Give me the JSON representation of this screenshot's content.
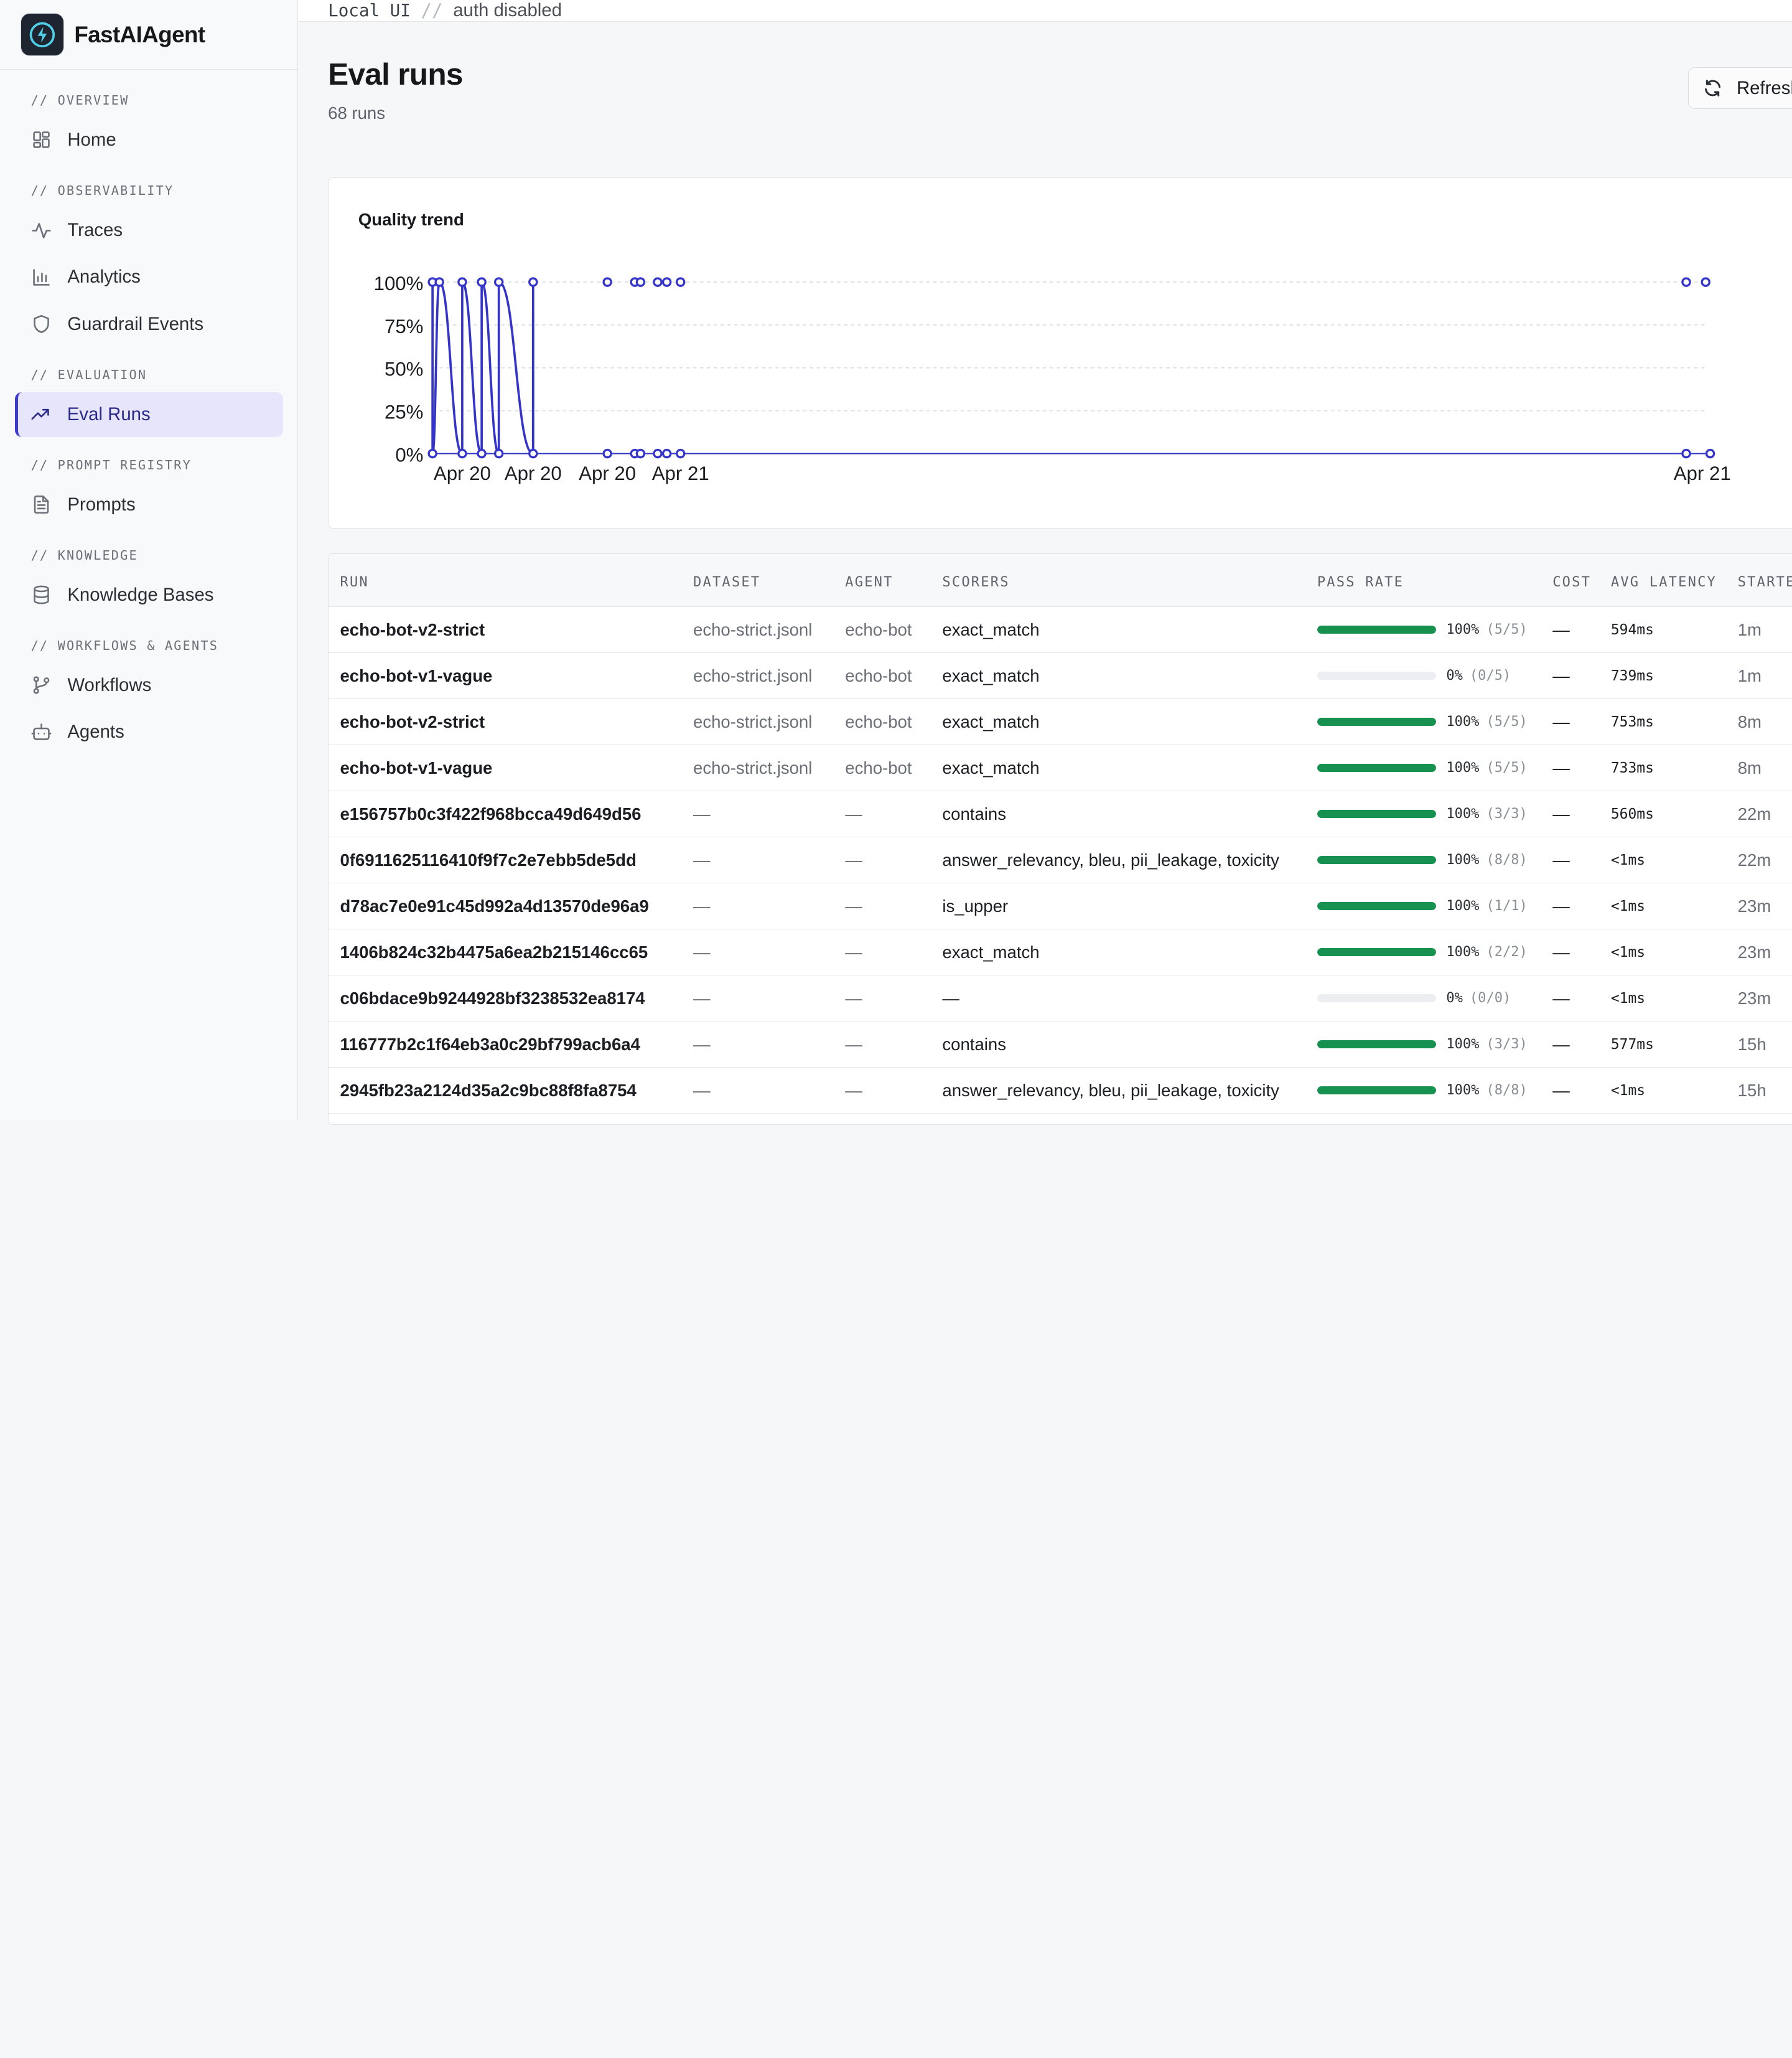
{
  "brand": {
    "name": "FastAIAgent"
  },
  "topbar": {
    "mode": "Local UI",
    "separator": "//",
    "auth": "auth disabled"
  },
  "nav": {
    "sections": [
      {
        "heading": "// OVERVIEW",
        "items": [
          {
            "label": "Home",
            "icon": "grid-icon"
          }
        ]
      },
      {
        "heading": "// OBSERVABILITY",
        "items": [
          {
            "label": "Traces",
            "icon": "pulse-icon"
          },
          {
            "label": "Analytics",
            "icon": "bar-chart-icon"
          },
          {
            "label": "Guardrail Events",
            "icon": "shield-icon"
          }
        ]
      },
      {
        "heading": "// EVALUATION",
        "items": [
          {
            "label": "Eval Runs",
            "icon": "trending-up-icon",
            "active": true
          }
        ]
      },
      {
        "heading": "// PROMPT REGISTRY",
        "items": [
          {
            "label": "Prompts",
            "icon": "document-icon"
          }
        ]
      },
      {
        "heading": "// KNOWLEDGE",
        "items": [
          {
            "label": "Knowledge Bases",
            "icon": "database-icon"
          }
        ]
      },
      {
        "heading": "// WORKFLOWS & AGENTS",
        "items": [
          {
            "label": "Workflows",
            "icon": "branch-icon"
          },
          {
            "label": "Agents",
            "icon": "robot-icon"
          }
        ]
      }
    ]
  },
  "page": {
    "title": "Eval runs",
    "subtitle": "68 runs",
    "refresh_label": "Refresh"
  },
  "chart_data": {
    "type": "line",
    "title": "Quality trend",
    "ylim": [
      0,
      100
    ],
    "yticks": [
      "0%",
      "25%",
      "50%",
      "75%",
      "100%"
    ],
    "xticks": [
      "Apr 20",
      "Apr 20",
      "Apr 20",
      "Apr 21",
      "Apr 21"
    ],
    "grid": true,
    "series": [
      {
        "values": [
          100,
          0,
          100,
          0,
          100,
          0,
          100,
          0,
          100,
          0,
          100,
          0,
          100,
          0,
          100,
          0,
          100,
          0,
          100,
          0,
          100,
          0,
          100,
          0,
          100,
          0,
          100,
          0,
          100,
          0,
          100,
          0,
          100,
          0
        ]
      }
    ]
  },
  "table": {
    "columns": [
      "RUN",
      "DATASET",
      "AGENT",
      "SCORERS",
      "PASS RATE",
      "COST",
      "AVG LATENCY",
      "STARTED"
    ],
    "rows": [
      {
        "run": "echo-bot-v2-strict",
        "dataset": "echo-strict.jsonl",
        "agent": "echo-bot",
        "scorers": "exact_match",
        "pass": 100,
        "pct": "100%",
        "frac": "(5/5)",
        "cost": "—",
        "latency": "594ms",
        "started": "1m"
      },
      {
        "run": "echo-bot-v1-vague",
        "dataset": "echo-strict.jsonl",
        "agent": "echo-bot",
        "scorers": "exact_match",
        "pass": 0,
        "pct": "0%",
        "frac": "(0/5)",
        "cost": "—",
        "latency": "739ms",
        "started": "1m"
      },
      {
        "run": "echo-bot-v2-strict",
        "dataset": "echo-strict.jsonl",
        "agent": "echo-bot",
        "scorers": "exact_match",
        "pass": 100,
        "pct": "100%",
        "frac": "(5/5)",
        "cost": "—",
        "latency": "753ms",
        "started": "8m"
      },
      {
        "run": "echo-bot-v1-vague",
        "dataset": "echo-strict.jsonl",
        "agent": "echo-bot",
        "scorers": "exact_match",
        "pass": 100,
        "pct": "100%",
        "frac": "(5/5)",
        "cost": "—",
        "latency": "733ms",
        "started": "8m"
      },
      {
        "run": "e156757b0c3f422f968bcca49d649d56",
        "dataset": "—",
        "agent": "—",
        "scorers": "contains",
        "pass": 100,
        "pct": "100%",
        "frac": "(3/3)",
        "cost": "—",
        "latency": "560ms",
        "started": "22m"
      },
      {
        "run": "0f6911625116410f9f7c2e7ebb5de5dd",
        "dataset": "—",
        "agent": "—",
        "scorers": "answer_relevancy, bleu, pii_leakage, toxicity",
        "pass": 100,
        "pct": "100%",
        "frac": "(8/8)",
        "cost": "—",
        "latency": "<1ms",
        "started": "22m"
      },
      {
        "run": "d78ac7e0e91c45d992a4d13570de96a9",
        "dataset": "—",
        "agent": "—",
        "scorers": "is_upper",
        "pass": 100,
        "pct": "100%",
        "frac": "(1/1)",
        "cost": "—",
        "latency": "<1ms",
        "started": "23m"
      },
      {
        "run": "1406b824c32b4475a6ea2b215146cc65",
        "dataset": "—",
        "agent": "—",
        "scorers": "exact_match",
        "pass": 100,
        "pct": "100%",
        "frac": "(2/2)",
        "cost": "—",
        "latency": "<1ms",
        "started": "23m"
      },
      {
        "run": "c06bdace9b9244928bf3238532ea8174",
        "dataset": "—",
        "agent": "—",
        "scorers": "—",
        "pass": 0,
        "pct": "0%",
        "frac": "(0/0)",
        "cost": "—",
        "latency": "<1ms",
        "started": "23m"
      },
      {
        "run": "116777b2c1f64eb3a0c29bf799acb6a4",
        "dataset": "—",
        "agent": "—",
        "scorers": "contains",
        "pass": 100,
        "pct": "100%",
        "frac": "(3/3)",
        "cost": "—",
        "latency": "577ms",
        "started": "15h"
      },
      {
        "run": "2945fb23a2124d35a2c9bc88f8fa8754",
        "dataset": "—",
        "agent": "—",
        "scorers": "answer_relevancy, bleu, pii_leakage, toxicity",
        "pass": 100,
        "pct": "100%",
        "frac": "(8/8)",
        "cost": "—",
        "latency": "<1ms",
        "started": "15h"
      }
    ]
  },
  "colors": {
    "accent": "#3b3bcf",
    "pass": "#16914f"
  }
}
